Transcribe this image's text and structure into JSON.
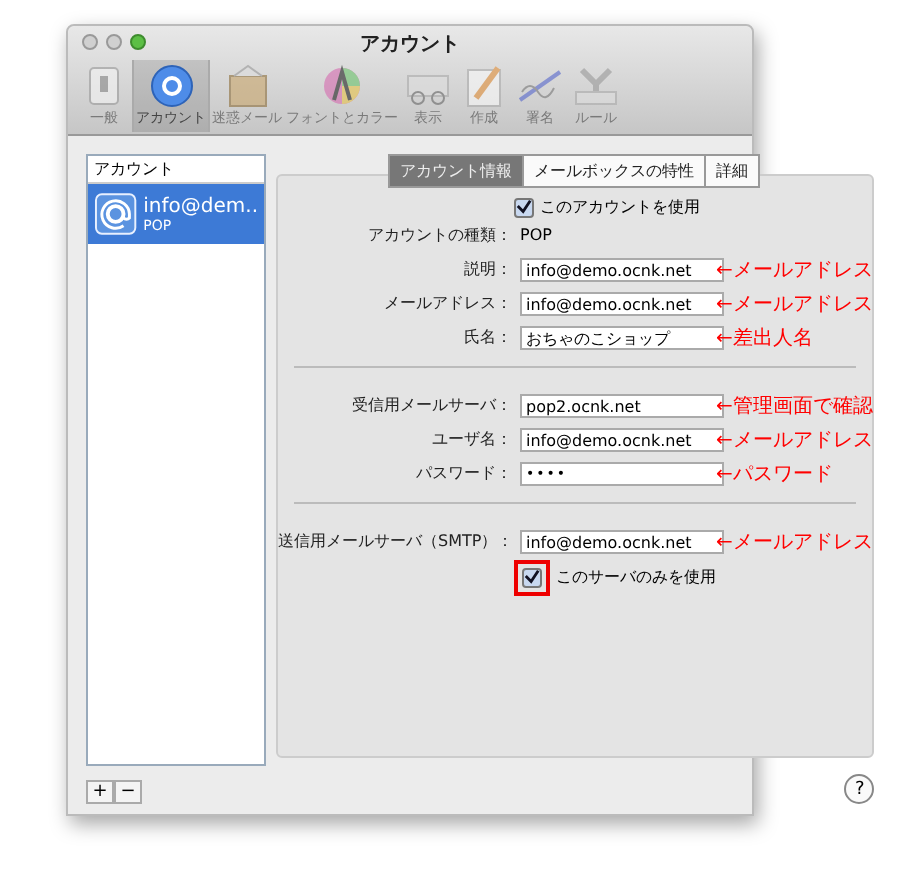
{
  "window": {
    "title": "アカウント"
  },
  "toolbar": [
    {
      "label": "一般",
      "selected": false
    },
    {
      "label": "アカウント",
      "selected": true
    },
    {
      "label": "迷惑メール",
      "selected": false
    },
    {
      "label": "フォントとカラー",
      "selected": false
    },
    {
      "label": "表示",
      "selected": false
    },
    {
      "label": "作成",
      "selected": false
    },
    {
      "label": "署名",
      "selected": false
    },
    {
      "label": "ルール",
      "selected": false
    }
  ],
  "sidebar": {
    "header": "アカウント",
    "accounts": [
      {
        "name": "info@dem..",
        "type": "POP",
        "selected": true
      }
    ]
  },
  "tabs": [
    {
      "label": "アカウント情報",
      "selected": true
    },
    {
      "label": "メールボックスの特性",
      "selected": false
    },
    {
      "label": "詳細",
      "selected": false
    }
  ],
  "use_account": {
    "label": "このアカウントを使用",
    "checked": true
  },
  "account_type": {
    "label": "アカウントの種類：",
    "value": "POP"
  },
  "groups": [
    [
      {
        "label": "説明：",
        "value": "info@demo.ocnk.net",
        "kind": "text",
        "note": "←メールアドレス"
      },
      {
        "label": "メールアドレス：",
        "value": "info@demo.ocnk.net",
        "kind": "text",
        "note": "←メールアドレス"
      },
      {
        "label": "氏名：",
        "value": "おちゃのこショップ",
        "kind": "text",
        "note": "←差出人名"
      }
    ],
    [
      {
        "label": "受信用メールサーバ：",
        "value": "pop2.ocnk.net",
        "kind": "text",
        "note": "←管理画面で確認"
      },
      {
        "label": "ユーザ名：",
        "value": "info@demo.ocnk.net",
        "kind": "text",
        "note": "←メールアドレス"
      },
      {
        "label": "パスワード：",
        "value": "••••",
        "kind": "password",
        "note": "←パスワード"
      }
    ],
    [
      {
        "label": "送信用メールサーバ（SMTP）：",
        "value": "info@demo.ocnk.net",
        "kind": "text",
        "note": "←メールアドレス"
      }
    ]
  ],
  "smtp_only": {
    "label": "このサーバのみを使用",
    "checked": true,
    "highlighted": true
  },
  "footer": {
    "add": "+",
    "remove": "−",
    "help": "?"
  }
}
